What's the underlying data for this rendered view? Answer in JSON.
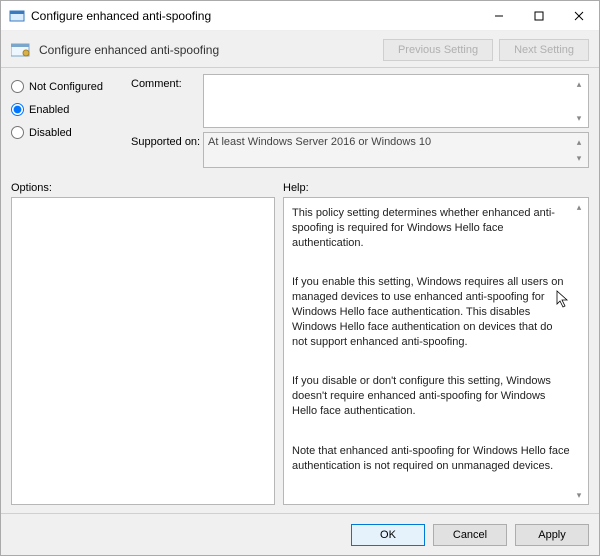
{
  "titlebar": {
    "title": "Configure enhanced anti-spoofing"
  },
  "header": {
    "page_title": "Configure enhanced anti-spoofing",
    "prev_label": "Previous Setting",
    "next_label": "Next Setting"
  },
  "radios": {
    "not_configured": "Not Configured",
    "enabled": "Enabled",
    "disabled": "Disabled",
    "selected": "enabled"
  },
  "fields": {
    "comment_label": "Comment:",
    "comment_value": "",
    "supported_label": "Supported on:",
    "supported_value": "At least Windows Server 2016 or Windows 10"
  },
  "labels": {
    "options": "Options:",
    "help": "Help:"
  },
  "help": {
    "p1": "This policy setting determines whether enhanced anti-spoofing is required for Windows Hello face authentication.",
    "p2": "If you enable this setting, Windows requires all users on managed devices to use enhanced anti-spoofing for Windows Hello face authentication. This disables Windows Hello face authentication on devices that do not support enhanced anti-spoofing.",
    "p3": "If you disable or don't configure this setting, Windows doesn't require enhanced anti-spoofing for Windows Hello face authentication.",
    "p4": "Note that enhanced anti-spoofing for Windows Hello face authentication is not required on unmanaged devices."
  },
  "footer": {
    "ok": "OK",
    "cancel": "Cancel",
    "apply": "Apply"
  }
}
